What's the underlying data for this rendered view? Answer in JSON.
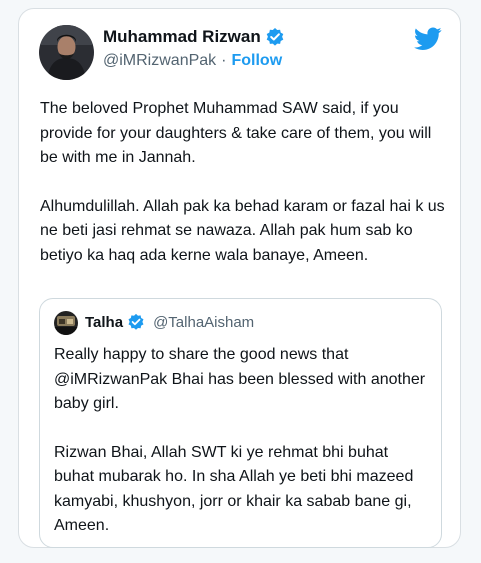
{
  "author": {
    "name": "Muhammad Rizwan",
    "handle": "@iMRizwanPak",
    "separator": "·",
    "follow_label": "Follow"
  },
  "tweet": {
    "paragraphs": [
      "The beloved Prophet Muhammad SAW said, if you provide for your daughters & take care of them, you will be with me in Jannah.",
      "Alhumdulillah. Allah pak ka behad karam or fazal hai k us ne beti jasi rehmat se nawaza. Allah pak hum sab ko betiyo ka haq ada kerne wala banaye, Ameen."
    ]
  },
  "quoted": {
    "name": "Talha",
    "handle": "@TalhaAisham",
    "paragraphs": [
      "Really happy to share the good news that @iMRizwanPak Bhai has been blessed with another baby girl.",
      "Rizwan Bhai, Allah SWT ki ye rehmat bhi buhat buhat mubarak ho. In sha Allah ye beti bhi mazeed kamyabi, khushyon, jorr or khair ka sabab bane gi, Ameen."
    ]
  },
  "colors": {
    "accent": "#1d9bf0",
    "text": "#0f1419",
    "muted": "#536471"
  },
  "icons": {
    "brand": "twitter-bird-icon",
    "verified": "verified-badge-icon"
  }
}
